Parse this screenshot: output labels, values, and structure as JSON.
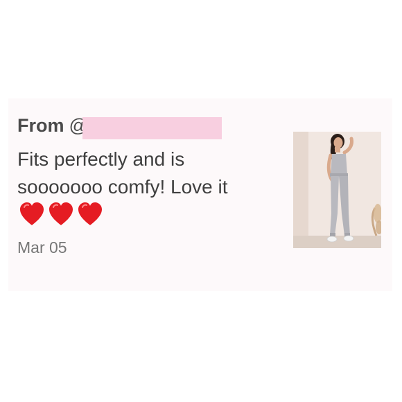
{
  "review": {
    "from_label": "From",
    "handle_prefix": "@",
    "text": "Fits perfectly and is sooooooo comfy!  Love it",
    "hearts": [
      "heart-icon",
      "heart-icon",
      "heart-icon"
    ],
    "date": "Mar 05"
  },
  "colors": {
    "card_background": "#fdf9fa",
    "redaction": "#f8cfe0",
    "heart": "#e51c23",
    "text": "#3f3f3f",
    "muted": "#777777"
  }
}
